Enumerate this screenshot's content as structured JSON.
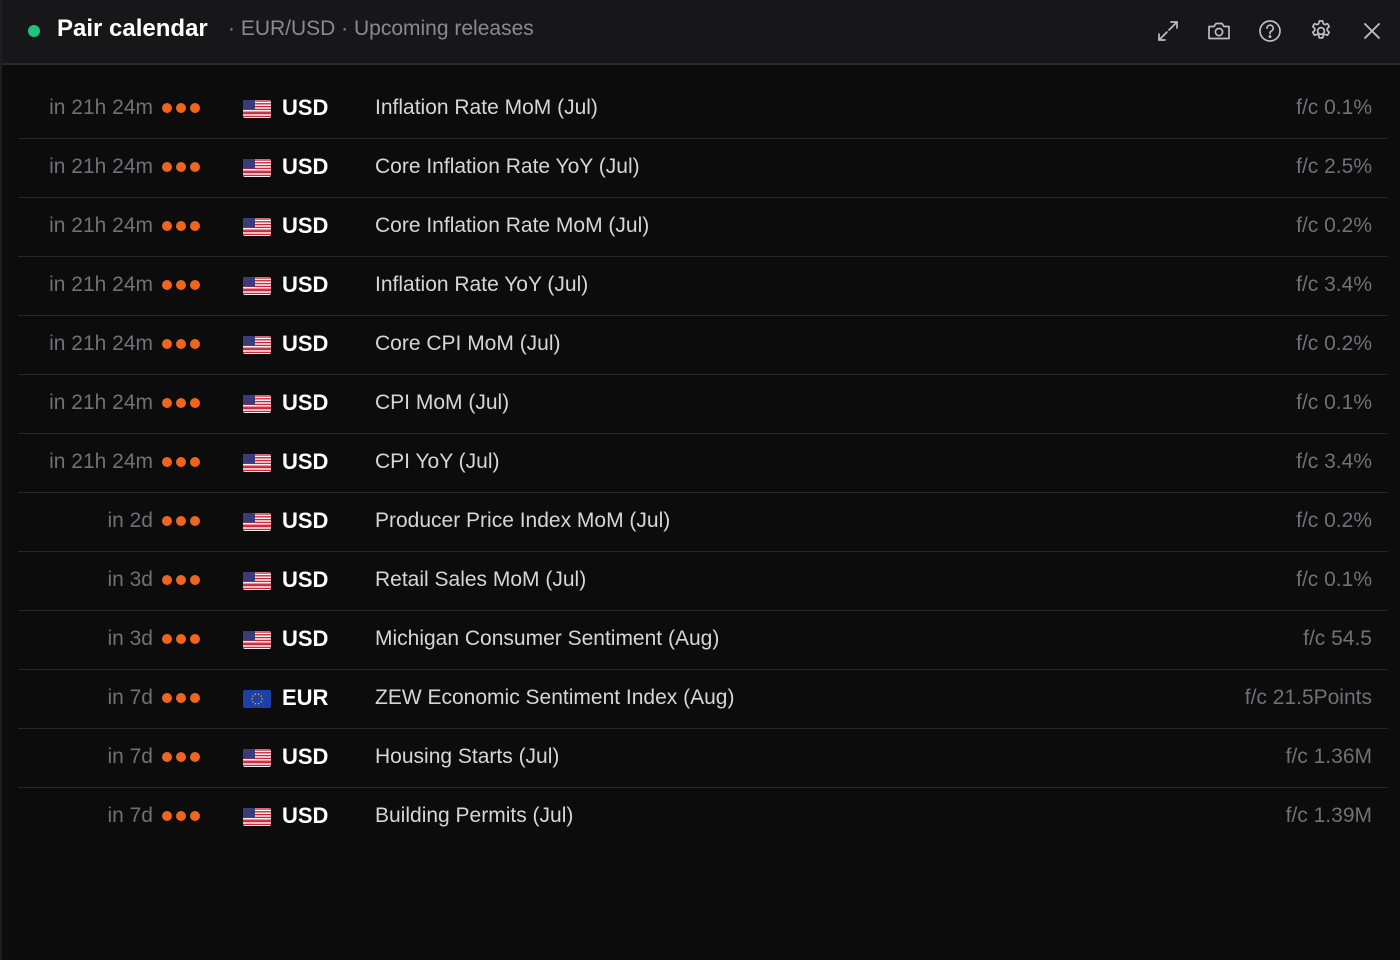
{
  "colors": {
    "status_dot": "#21c37a",
    "impact_dot": "#f0651e",
    "background": "#0c0c0d",
    "header_bg": "#17171a"
  },
  "header": {
    "title": "Pair calendar",
    "subtitle": "· EUR/USD · Upcoming releases",
    "icons": [
      "expand-icon",
      "camera-icon",
      "help-icon",
      "gear-icon",
      "close-icon"
    ]
  },
  "events": [
    {
      "time": "in 21h 24m",
      "impact": 3,
      "flag": "us",
      "currency": "USD",
      "event": "Inflation Rate MoM (Jul)",
      "forecast": "f/c 0.1%"
    },
    {
      "time": "in 21h 24m",
      "impact": 3,
      "flag": "us",
      "currency": "USD",
      "event": "Core Inflation Rate YoY (Jul)",
      "forecast": "f/c 2.5%"
    },
    {
      "time": "in 21h 24m",
      "impact": 3,
      "flag": "us",
      "currency": "USD",
      "event": "Core Inflation Rate MoM (Jul)",
      "forecast": "f/c 0.2%"
    },
    {
      "time": "in 21h 24m",
      "impact": 3,
      "flag": "us",
      "currency": "USD",
      "event": "Inflation Rate YoY (Jul)",
      "forecast": "f/c 3.4%"
    },
    {
      "time": "in 21h 24m",
      "impact": 3,
      "flag": "us",
      "currency": "USD",
      "event": "Core CPI MoM (Jul)",
      "forecast": "f/c 0.2%"
    },
    {
      "time": "in 21h 24m",
      "impact": 3,
      "flag": "us",
      "currency": "USD",
      "event": "CPI MoM (Jul)",
      "forecast": "f/c 0.1%"
    },
    {
      "time": "in 21h 24m",
      "impact": 3,
      "flag": "us",
      "currency": "USD",
      "event": "CPI YoY (Jul)",
      "forecast": "f/c 3.4%"
    },
    {
      "time": "in 2d",
      "impact": 3,
      "flag": "us",
      "currency": "USD",
      "event": "Producer Price Index MoM (Jul)",
      "forecast": "f/c 0.2%"
    },
    {
      "time": "in 3d",
      "impact": 3,
      "flag": "us",
      "currency": "USD",
      "event": "Retail Sales MoM (Jul)",
      "forecast": "f/c 0.1%"
    },
    {
      "time": "in 3d",
      "impact": 3,
      "flag": "us",
      "currency": "USD",
      "event": "Michigan Consumer Sentiment (Aug)",
      "forecast": "f/c 54.5"
    },
    {
      "time": "in 7d",
      "impact": 3,
      "flag": "eu",
      "currency": "EUR",
      "event": "ZEW Economic Sentiment Index (Aug)",
      "forecast": "f/c 21.5Points"
    },
    {
      "time": "in 7d",
      "impact": 3,
      "flag": "us",
      "currency": "USD",
      "event": "Housing Starts (Jul)",
      "forecast": "f/c 1.36M"
    },
    {
      "time": "in 7d",
      "impact": 3,
      "flag": "us",
      "currency": "USD",
      "event": "Building Permits (Jul)",
      "forecast": "f/c 1.39M"
    }
  ]
}
